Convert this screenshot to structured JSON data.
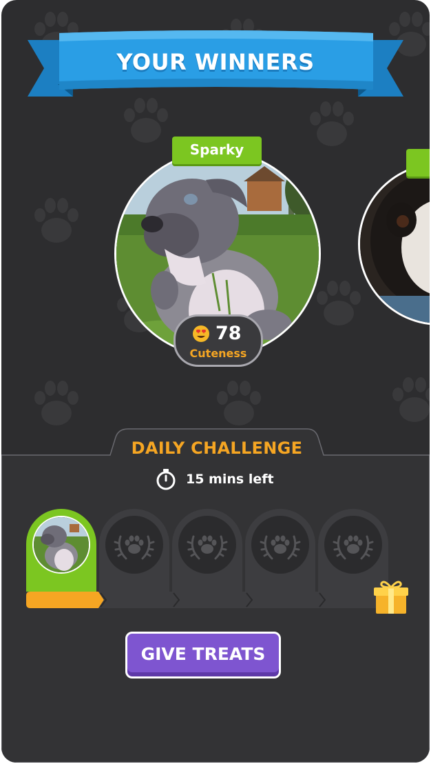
{
  "header": {
    "title": "YOUR WINNERS"
  },
  "winners": [
    {
      "name": "Sparky",
      "score": "78",
      "score_label": "Cuteness",
      "score_icon": "heart-eyes-emoji-icon"
    },
    {
      "name": "",
      "photo": "shih-tzu-dog-photo"
    }
  ],
  "challenge": {
    "title": "DAILY CHALLENGE",
    "timer_text": "15 mins left",
    "progress": 0.21,
    "slots": [
      {
        "state": "completed",
        "image": "sparky-thumbnail"
      },
      {
        "state": "locked",
        "icon": "paw-wreath-icon"
      },
      {
        "state": "locked",
        "icon": "paw-wreath-icon"
      },
      {
        "state": "locked",
        "icon": "paw-wreath-icon"
      },
      {
        "state": "locked",
        "icon": "paw-wreath-icon"
      }
    ],
    "reward_icon": "gift-box-icon"
  },
  "actions": {
    "give_treats_label": "GIVE TREATS"
  },
  "colors": {
    "background": "#2d2d2f",
    "ribbon": "#2a9ee5",
    "name_tag": "#7cc621",
    "accent_orange": "#f6a623",
    "button_purple": "#7e55d0"
  }
}
